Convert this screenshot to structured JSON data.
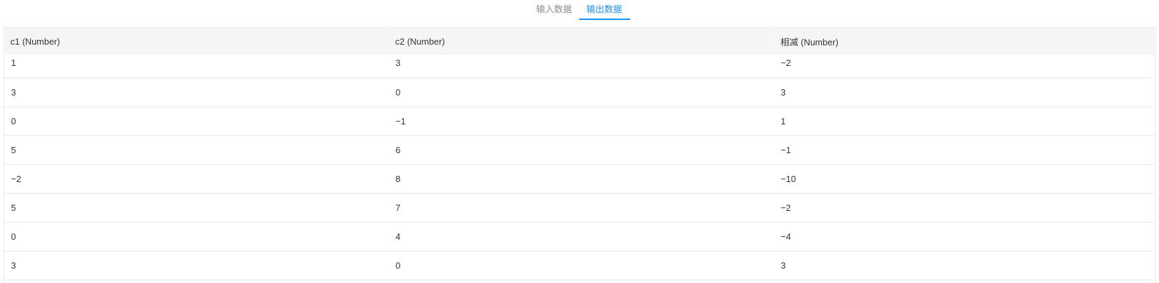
{
  "tabs": [
    {
      "label": "输入数据",
      "active": false
    },
    {
      "label": "输出数据",
      "active": true
    }
  ],
  "colors": {
    "accent": "#1890ff",
    "header_bg": "#f5f5f5",
    "inactive_tab": "#8c8c8c"
  },
  "table": {
    "columns": [
      "c1 (Number)",
      "c2 (Number)",
      "相减 (Number)"
    ],
    "rows": [
      [
        "1",
        "3",
        "−2"
      ],
      [
        "3",
        "0",
        "3"
      ],
      [
        "0",
        "−1",
        "1"
      ],
      [
        "5",
        "6",
        "−1"
      ],
      [
        "−2",
        "8",
        "−10"
      ],
      [
        "5",
        "7",
        "−2"
      ],
      [
        "0",
        "4",
        "−4"
      ],
      [
        "3",
        "0",
        "3"
      ]
    ]
  }
}
